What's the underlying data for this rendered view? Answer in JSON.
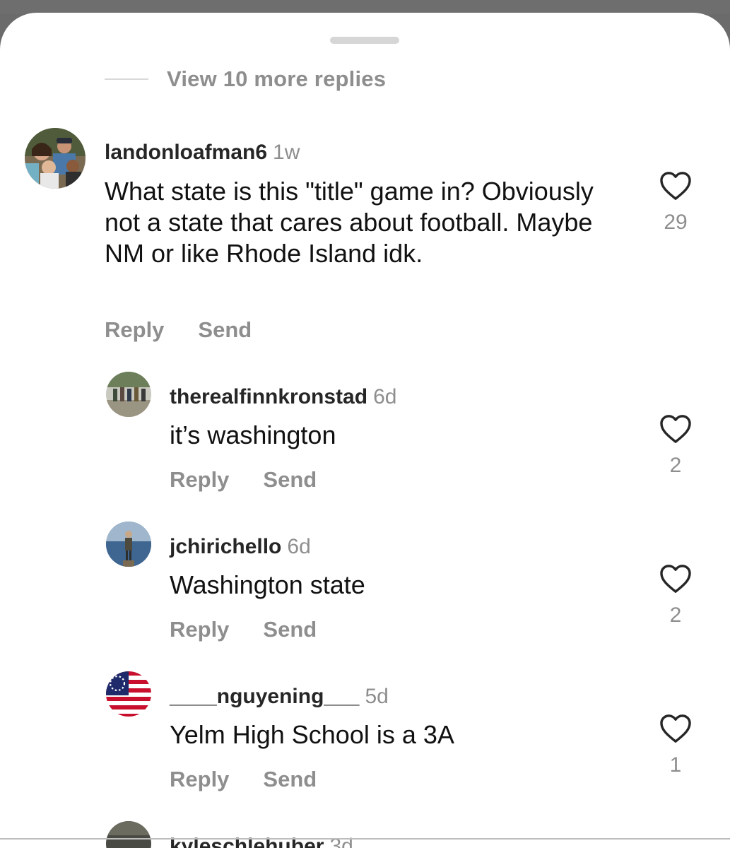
{
  "sheet": {
    "view_more_label": "View 10 more replies"
  },
  "comments": [
    {
      "username": "landonloafman6",
      "time": "1w",
      "text": "What state is this \"title\" game in? Obviously not a state that cares about football. Maybe NM or like Rhode Island idk.",
      "reply_label": "Reply",
      "send_label": "Send",
      "likes": "29"
    },
    {
      "username": "therealfinnkronstad",
      "time": "6d",
      "text": "it’s washington",
      "reply_label": "Reply",
      "send_label": "Send",
      "likes": "2"
    },
    {
      "username": "jchirichello",
      "time": "6d",
      "text": "Washington state",
      "reply_label": "Reply",
      "send_label": "Send",
      "likes": "2"
    },
    {
      "username": "____nguyening___",
      "time": "5d",
      "text": "Yelm High School is a 3A",
      "reply_label": "Reply",
      "send_label": "Send",
      "likes": "1"
    },
    {
      "username": "kyleschlehuber",
      "time": "3d"
    }
  ],
  "colors": {
    "username": "#262626",
    "secondary": "#8e8e8e",
    "body": "#111111"
  }
}
